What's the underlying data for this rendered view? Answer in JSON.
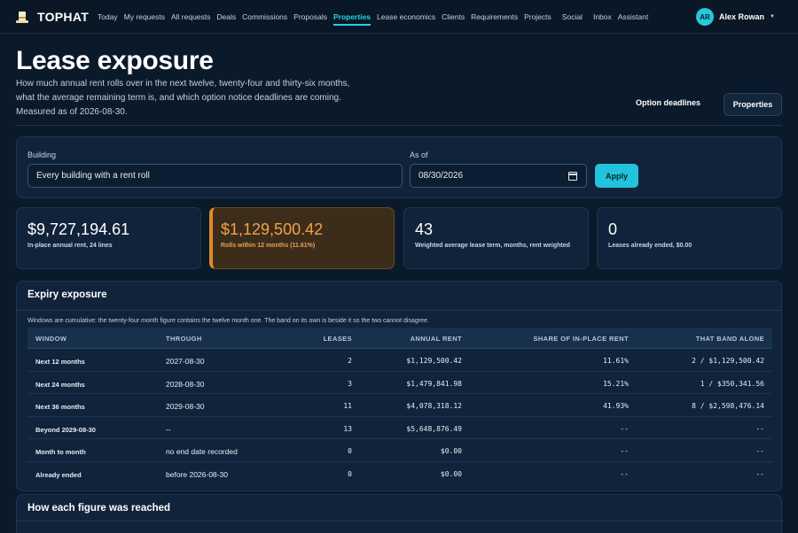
{
  "nav": {
    "brand": "TOPHAT",
    "links": [
      "Today",
      "My requests",
      "All requests",
      "Deals",
      "Commissions",
      "Proposals",
      "Properties",
      "Lease economics",
      "Clients",
      "Requirements",
      "Projects",
      "Social",
      "Inbox",
      "Assistant"
    ],
    "active": "Properties",
    "user": {
      "initials": "AR",
      "name": "Alex Rowan"
    }
  },
  "header": {
    "title": "Lease exposure",
    "subtitle": "How much annual rent rolls over in the next twelve, twenty-four and thirty-six months, what the average remaining term is, and which option notice deadlines are coming. Measured as of 2026-08-30.",
    "option_deadlines_label": "Option deadlines",
    "properties_label": "Properties"
  },
  "filter": {
    "building_label": "Building",
    "building_value": "Every building with a rent roll",
    "asof_label": "As of",
    "asof_value": "08/30/2026",
    "apply_label": "Apply"
  },
  "stats": [
    {
      "value": "$9,727,194.61",
      "label": "In-place annual rent, 24 lines"
    },
    {
      "value": "$1,129,500.42",
      "label": "Rolls within 12 months (11.61%)"
    },
    {
      "value": "43",
      "label": "Weighted average lease term, months, rent weighted"
    },
    {
      "value": "0",
      "label": "Leases already ended, $0.00"
    }
  ],
  "exposure": {
    "title": "Expiry exposure",
    "note": "Windows are cumulative: the twenty-four month figure contains the twelve month one. The band on its own is beside it so the two cannot disagree.",
    "columns": [
      "WINDOW",
      "THROUGH",
      "LEASES",
      "ANNUAL RENT",
      "SHARE OF IN-PLACE RENT",
      "THAT BAND ALONE"
    ],
    "rows": [
      {
        "window": "Next 12 months",
        "through": "2027-08-30",
        "leases": "2",
        "rent": "$1,129,500.42",
        "share": "11.61%",
        "band": "2 / $1,129,500.42"
      },
      {
        "window": "Next 24 months",
        "through": "2028-08-30",
        "leases": "3",
        "rent": "$1,479,841.98",
        "share": "15.21%",
        "band": "1 / $350,341.56"
      },
      {
        "window": "Next 36 months",
        "through": "2029-08-30",
        "leases": "11",
        "rent": "$4,078,318.12",
        "share": "41.93%",
        "band": "8 / $2,598,476.14"
      },
      {
        "window": "Beyond 2029-08-30",
        "through": "--",
        "leases": "13",
        "rent": "$5,648,876.49",
        "share": "--",
        "band": "--"
      },
      {
        "window": "Month to month",
        "through": "no end date recorded",
        "leases": "0",
        "rent": "$0.00",
        "share": "--",
        "band": "--"
      },
      {
        "window": "Already ended",
        "through": "before 2026-08-30",
        "leases": "0",
        "rent": "$0.00",
        "share": "--",
        "band": "--"
      }
    ]
  },
  "how": {
    "title": "How each figure was reached"
  }
}
